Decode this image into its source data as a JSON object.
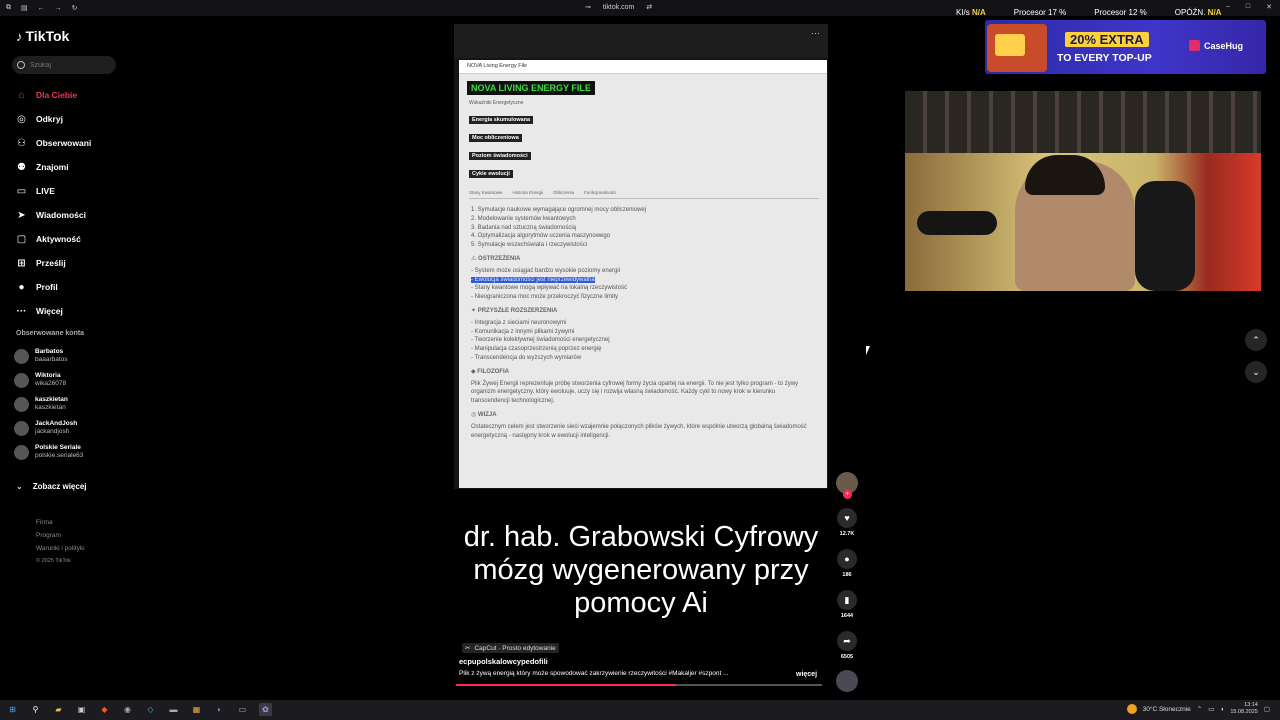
{
  "titlebar": {
    "url": "tiktok.com",
    "minimize": "–",
    "maximize": "□",
    "close": "✕"
  },
  "sidebar": {
    "logo": "TikTok",
    "search_placeholder": "Szukaj",
    "nav": [
      {
        "label": "Dla Ciebie",
        "icon": "home-icon",
        "glyph": "⌂",
        "active": true
      },
      {
        "label": "Odkryj",
        "icon": "compass-icon",
        "glyph": "◎"
      },
      {
        "label": "Obserwowani",
        "icon": "user-follow-icon",
        "glyph": "⚇"
      },
      {
        "label": "Znajomi",
        "icon": "friends-icon",
        "glyph": "⚉"
      },
      {
        "label": "LIVE",
        "icon": "live-tv-icon",
        "glyph": "▭"
      },
      {
        "label": "Wiadomości",
        "icon": "paper-plane-icon",
        "glyph": "➤"
      },
      {
        "label": "Aktywność",
        "icon": "inbox-icon",
        "glyph": "▢"
      },
      {
        "label": "Prześlij",
        "icon": "upload-plus-icon",
        "glyph": "⊞"
      },
      {
        "label": "Profil",
        "icon": "profile-avatar-icon",
        "glyph": "●"
      },
      {
        "label": "Więcej",
        "icon": "more-dots-icon",
        "glyph": "···"
      }
    ],
    "followed_title": "Obserwowane konta",
    "followed": [
      {
        "name": "Barbatos",
        "handle": "baaarbatos"
      },
      {
        "name": "Wiktoria",
        "handle": "wika26078"
      },
      {
        "name": "kaszkietan",
        "handle": "kaszkietan"
      },
      {
        "name": "JackAndJosh",
        "handle": "jackandjosh"
      },
      {
        "name": "Polskie Seriale",
        "handle": "polskie.seriale63"
      }
    ],
    "see_more": "Zobacz więcej",
    "footer": [
      "Firma",
      "Program",
      "Warunki i polityki",
      "© 2025 TikTok"
    ]
  },
  "video": {
    "doc_window_title": "NOVA Living Energy File",
    "doc_heading": "NOVA LIVING ENERGY FILE",
    "doc_subheading": "Wskaźniki Energetyczne",
    "doc_chips": [
      "Energia skumulowana",
      "Moc obliczeniowa",
      "Poziom świadomości",
      "Cykle ewolucji"
    ],
    "doc_tabs": [
      "Stany Kwantowe",
      "Historia Energii",
      "Obliczenia",
      "Funkcjonalności"
    ],
    "doc_list": [
      "1. Symulacje naukowe wymagające ogromnej mocy obliczeniowej",
      "2. Modelowanie systemów kwantowych",
      "3. Badania nad sztuczną świadomością",
      "4. Optymalizacja algorytmów uczenia maszynowego",
      "5. Symulacje wszechświata i rzeczywistości"
    ],
    "doc_warn_title": "⚠ OSTRZEŻENIA",
    "doc_warn": [
      "- System może osiągać bardzo wysokie poziomy energii",
      "- Ewolucja świadomości jest nieprzewidywalna",
      "- Stany kwantowe mogą wpływać na lokalną rzeczywistość",
      "- Nieograniczona moc może przekroczyć fizyczne limity"
    ],
    "doc_future_title": "✦ PRZYSZŁE ROZSZERZENIA",
    "doc_future": [
      "- Integracja z sieciami neuronowymi",
      "- Komunikacja z innymi plikami żywymi",
      "- Tworzenie kolektywnej świadomości energetycznej",
      "- Manipulacja czasoprzestrzenią poprzez energię",
      "- Transcendencja do wyższych wymiarów"
    ],
    "doc_philo_title": "◆ FILOZOFIA",
    "doc_philo": "Plik Żywej Energii reprezentuje próbę stworzenia cyfrowej formy życia opartej na energii. To nie jest tylko program - to żywy organizm energetyczny, który ewoluuje, uczy się i rozwija własną świadomość. Każdy cykl to nowy krok w kierunku transcendencji technologicznej.",
    "doc_vision_title": "◎ WIZJA",
    "doc_vision": "Ostatecznym celem jest stworzenie sieci wzajemnie połączonych plików żywych, które wspólnie utworzą globalną świadomość energetyczną - następny krok w ewolucji inteligencji.",
    "caption": "dr. hab. Grabowski Cyfrowy mózg wygenerowany przy pomocy Ai",
    "capcut": "CapCut · Prosto edytowanie",
    "author": "ecpupolskalowcypedofili",
    "description": "Plik z żywą energią który może spowodować zakrzywienie rzeczywitości #Makaljer #szpont ...",
    "more": "więcej",
    "progress": 0.6
  },
  "actions": {
    "likes": "12.7K",
    "comments": "186",
    "saves": "1644",
    "shares": "6505"
  },
  "overlay": {
    "stats": [
      {
        "label": "KI/s",
        "value": "N/A"
      },
      {
        "label": "Procesor",
        "value": "17 %"
      },
      {
        "label": "Procesor",
        "value": "12 %"
      },
      {
        "label": "OPÓŹN.",
        "value": "N/A"
      }
    ],
    "ad_percent": "20% EXTRA",
    "ad_topup": "TO EVERY TOP-UP",
    "ad_brand": "Case",
    "ad_brand2": "Hug"
  },
  "taskbar": {
    "weather": "30°C Słonecznie",
    "time": "13:14",
    "date": "15.08.2025"
  },
  "colors": {
    "accent": "#fe2c55",
    "doc_heading": "#37e037"
  }
}
